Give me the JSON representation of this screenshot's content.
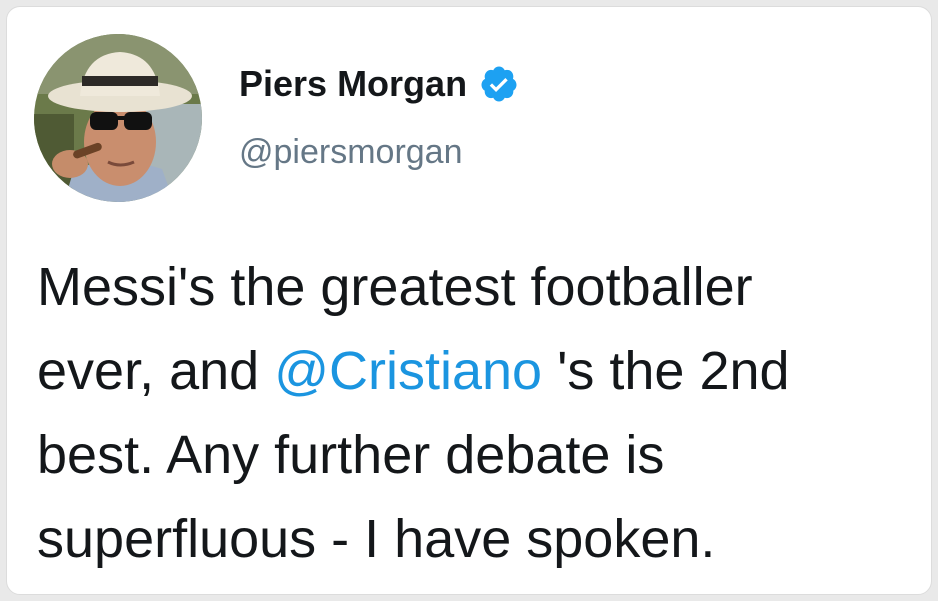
{
  "author": {
    "name": "Piers Morgan",
    "handle": "@piersmorgan",
    "verified_icon": "verified-badge-icon",
    "verified_color": "#1da1f2"
  },
  "tweet": {
    "line1": "Messi's the greatest footballer",
    "line2_pre": "ever, and ",
    "line2_mention": "@Cristiano",
    "line2_post": " 's the 2nd",
    "line3": "best. Any further debate is",
    "line4": "superfluous - I have spoken."
  },
  "colors": {
    "link": "#1b95e0",
    "text": "#14171a",
    "muted": "#657786"
  }
}
